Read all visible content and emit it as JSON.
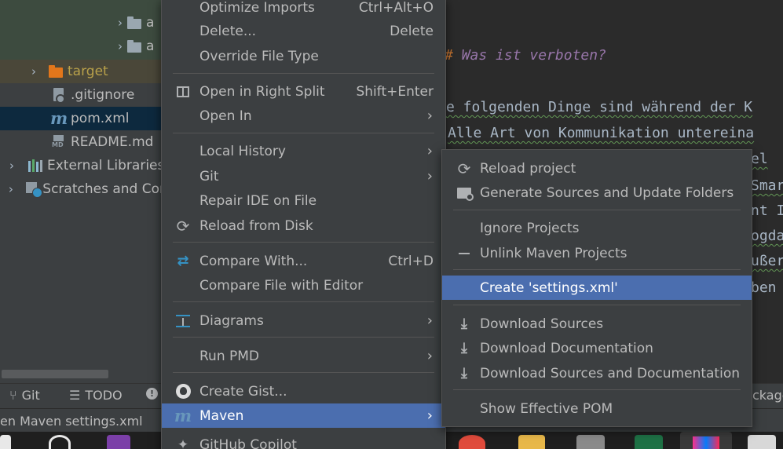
{
  "project_tree": {
    "rows": [
      {
        "label": "a",
        "icon": "folder-icon"
      },
      {
        "label": "a",
        "icon": "folder-icon"
      },
      {
        "label": "target",
        "icon": "folder-orange-icon",
        "color": "#b8a04a"
      },
      {
        "label": ".gitignore",
        "icon": "gitignore-file-icon"
      },
      {
        "label": "pom.xml",
        "icon": "maven-file-icon"
      },
      {
        "label": "README.md",
        "icon": "markdown-file-icon"
      },
      {
        "label": "External Libraries",
        "icon": "libraries-icon"
      },
      {
        "label": "Scratches and Cor",
        "icon": "scratches-icon"
      }
    ]
  },
  "editor": {
    "heading": "Was ist verboten?",
    "lines": [
      "e folgenden Dinge sind während der K",
      "Alle Art von Kommunikation untereina",
      "el",
      "Smar",
      "nt I",
      "ogda",
      "ußer",
      "ben"
    ]
  },
  "tool_window_bar": {
    "git_label": "Git",
    "todo_label": "TODO",
    "right_label": "ckage"
  },
  "status_bar": {
    "message": "en Maven settings.xml"
  },
  "context_menu": {
    "items": [
      {
        "label": "Optimize Imports",
        "shortcut": "Ctrl+Alt+O"
      },
      {
        "label": "Delete...",
        "shortcut": "Delete"
      },
      {
        "label": "Override File Type"
      },
      {
        "label": "Open in Right Split",
        "shortcut": "Shift+Enter"
      },
      {
        "label": "Open In"
      },
      {
        "label": "Local History"
      },
      {
        "label": "Git"
      },
      {
        "label": "Repair IDE on File"
      },
      {
        "label": "Reload from Disk"
      },
      {
        "label": "Compare With...",
        "shortcut": "Ctrl+D"
      },
      {
        "label": "Compare File with Editor"
      },
      {
        "label": "Diagrams"
      },
      {
        "label": "Run PMD"
      },
      {
        "label": "Create Gist..."
      },
      {
        "label": "Maven"
      },
      {
        "label": "GitHub Copilot"
      }
    ]
  },
  "maven_submenu": {
    "items": [
      {
        "label": "Reload project"
      },
      {
        "label": "Generate Sources and Update Folders"
      },
      {
        "label": "Ignore Projects"
      },
      {
        "label": "Unlink Maven Projects"
      },
      {
        "label": "Create 'settings.xml'"
      },
      {
        "label": "Download Sources"
      },
      {
        "label": "Download Documentation"
      },
      {
        "label": "Download Sources and Documentation"
      },
      {
        "label": "Show Effective POM"
      }
    ]
  },
  "colors": {
    "selection": "#4b6eaf",
    "menu_bg": "#3c3f41",
    "editor_bg": "#2b2b2b",
    "maven_blue": "#6897bb",
    "heading_purple": "#9876aa"
  }
}
